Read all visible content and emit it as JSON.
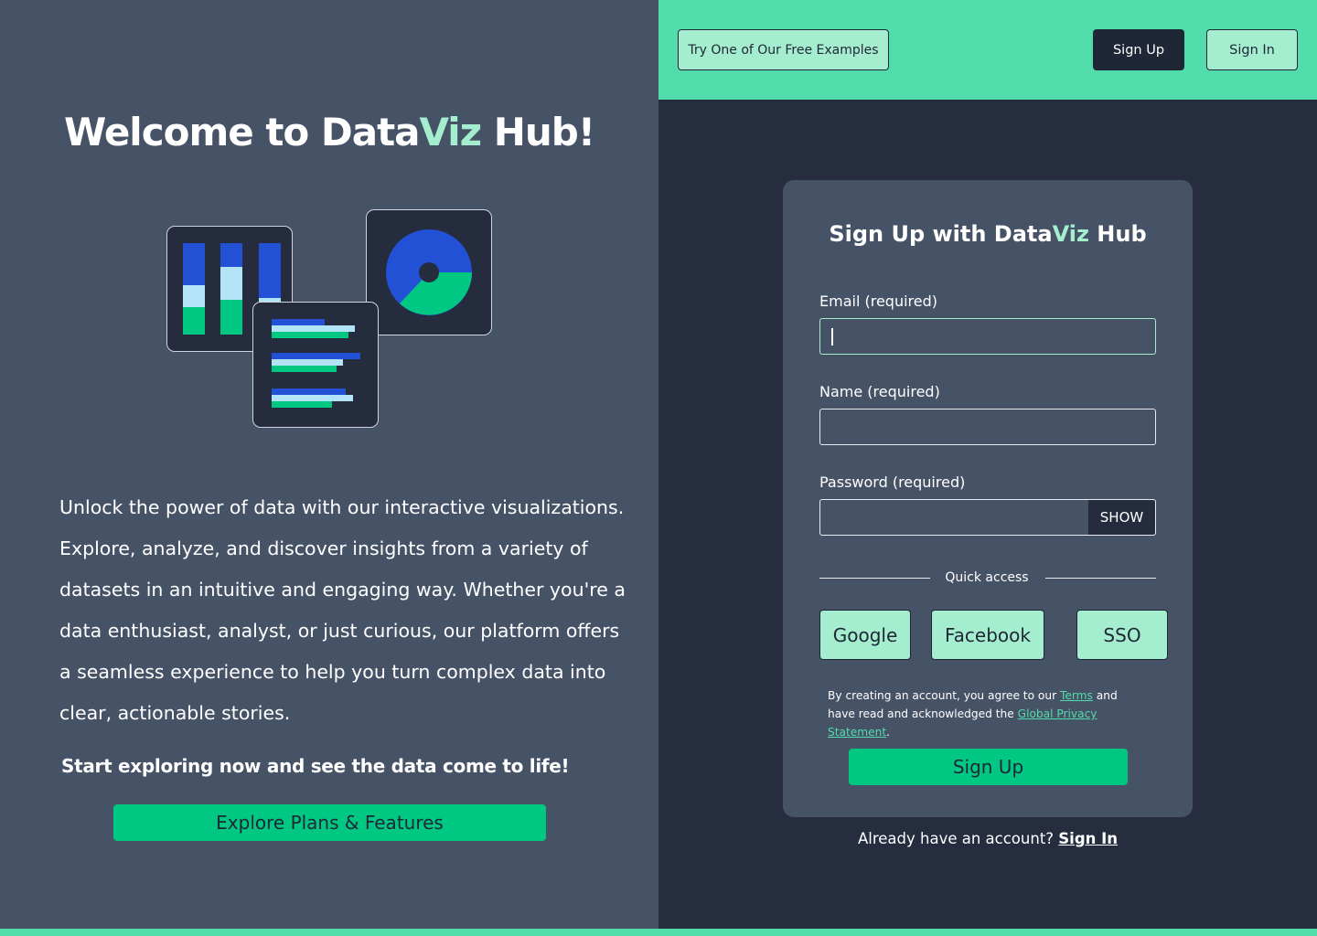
{
  "topbar": {
    "examples_label": "Try One of Our Free Examples",
    "signup_label": "Sign Up",
    "signin_label": "Sign In"
  },
  "hero": {
    "title_prefix": "Welcome to Data",
    "title_accent": "Viz",
    "title_suffix": " Hub!",
    "intro": "Unlock the power of data with our interactive visualizations. Explore, analyze, and discover insights from a variety of datasets in an intuitive and engaging way. Whether you're a data enthusiast, analyst, or just curious, our platform offers a seamless experience to help you turn complex data into clear, actionable stories.",
    "cta_line": "Start exploring now and see the data come to life!",
    "explore_button": "Explore Plans & Features"
  },
  "illustration": {
    "icons": [
      "bar-chart-icon",
      "horizontal-bar-chart-icon",
      "donut-chart-icon"
    ],
    "colors": {
      "blue": "#2251d6",
      "light_blue": "#b3e3f7",
      "green": "#00c883"
    }
  },
  "form": {
    "title_prefix": "Sign Up with Data",
    "title_accent": "Viz",
    "title_suffix": " Hub",
    "email_label": "Email (required)",
    "email_value": "",
    "name_label": "Name (required)",
    "name_value": "",
    "password_label": "Password (required)",
    "password_value": "",
    "show_label": "SHOW",
    "quick_access_label": "Quick access",
    "quick_buttons": [
      "Google",
      "Facebook",
      "SSO"
    ],
    "terms_prefix": "By creating an account, you agree to our ",
    "terms_link": "Terms",
    "terms_middle": " and have read and acknowledged the ",
    "privacy_link": "Global Privacy Statement",
    "terms_suffix": ".",
    "submit_label": "Sign Up",
    "already_text": "Already have an account? ",
    "signin_link": "Sign In"
  },
  "colors": {
    "accent_green": "#53dcab",
    "mint": "#a4edcf",
    "button_green": "#00c883",
    "dark_navy": "#1f2736",
    "panel_slate": "#465266"
  }
}
